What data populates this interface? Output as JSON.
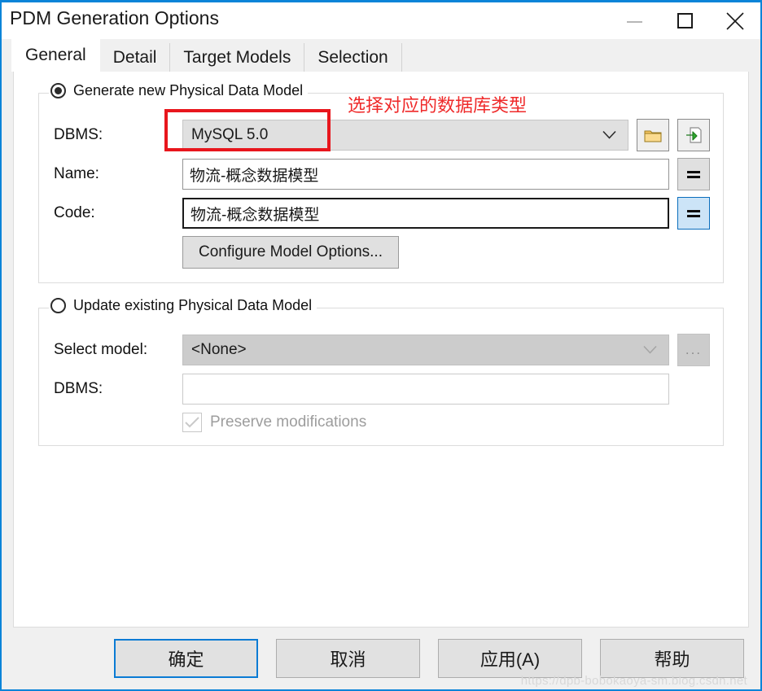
{
  "window": {
    "title": "PDM Generation Options",
    "controls": [
      {
        "name": "minimize",
        "glyph": "minimize-icon",
        "disabled": true
      },
      {
        "name": "maximize",
        "glyph": "maximize-icon",
        "disabled": false
      },
      {
        "name": "close",
        "glyph": "close-icon",
        "disabled": false
      }
    ]
  },
  "tabs": [
    {
      "label": "General",
      "active": true
    },
    {
      "label": "Detail",
      "active": false
    },
    {
      "label": "Target Models",
      "active": false
    },
    {
      "label": "Selection",
      "active": false
    }
  ],
  "generate_group": {
    "legend": "Generate new Physical Data Model",
    "selected": true,
    "dbms_label": "DBMS:",
    "dbms_value": "MySQL 5.0",
    "dbms_browse_icon": "folder-icon",
    "dbms_import_icon": "import-page-icon",
    "name_label": "Name:",
    "name_value": "物流-概念数据模型",
    "name_equals_label": "=",
    "code_label": "Code:",
    "code_value": "物流-概念数据模型",
    "code_equals_label": "=",
    "configure_button": "Configure Model Options..."
  },
  "update_group": {
    "legend": "Update existing Physical Data Model",
    "selected": false,
    "select_model_label": "Select model:",
    "select_model_value": "<None>",
    "browse_button_label": "...",
    "dbms_label": "DBMS:",
    "dbms_value": "",
    "preserve_label": "Preserve modifications",
    "preserve_checked": true,
    "preserve_disabled": true
  },
  "annotation": {
    "text": "选择对应的数据库类型",
    "color": "#ef2a2a",
    "box_color": "#e8161d"
  },
  "footer": {
    "buttons": [
      {
        "label": "确定",
        "default": true
      },
      {
        "label": "取消",
        "default": false
      },
      {
        "label": "应用(A)",
        "default": false
      },
      {
        "label": "帮助",
        "default": false
      }
    ]
  },
  "watermark": "https://dpb-bobokaoya-sm.blog.csdn.net",
  "colors": {
    "accent": "#0a84d8",
    "annotation_red": "#e8161d",
    "window_bg": "#f0f0f0",
    "page_bg": "#ffffff"
  }
}
